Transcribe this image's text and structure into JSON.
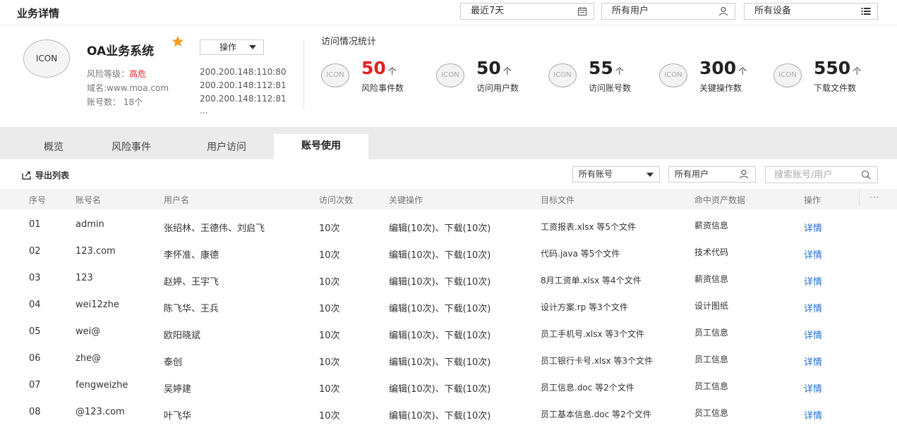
{
  "header": {
    "title": "业务详情",
    "date_filter": "最近7天",
    "user_filter": "所有用户",
    "device_filter": "所有设备"
  },
  "system": {
    "icon_label": "ICON",
    "name": "OA业务系统",
    "operation_label": "操作",
    "risk_label": "风险等级：",
    "risk_value": "高危",
    "domain": "域名:www.moa.com",
    "account_count": "账号数：  18个",
    "ips": [
      "200.200.148:110:80",
      "200.200.148:112:81",
      "200.200.148:112:81",
      "..."
    ],
    "accent_color": "#f0a020",
    "risk_color": "#e22222"
  },
  "stats": {
    "title": "访问情况统计",
    "items": [
      {
        "icon": "ICON",
        "value": "50",
        "unit": "个",
        "label": "风险事件数",
        "highlight": true
      },
      {
        "icon": "ICON",
        "value": "50",
        "unit": "个",
        "label": "访问用户数",
        "highlight": false
      },
      {
        "icon": "ICON",
        "value": "55",
        "unit": "个",
        "label": "访问账号数",
        "highlight": false
      },
      {
        "icon": "ICON",
        "value": "300",
        "unit": "个",
        "label": "关键操作数",
        "highlight": false
      },
      {
        "icon": "ICON",
        "value": "550",
        "unit": "个",
        "label": "下载文件数",
        "highlight": false
      }
    ]
  },
  "tabs": [
    {
      "label": "概览",
      "active": false
    },
    {
      "label": "风险事件",
      "active": false
    },
    {
      "label": "用户访问",
      "active": false
    },
    {
      "label": "账号使用",
      "active": true
    }
  ],
  "toolbar": {
    "export_label": "导出列表",
    "account_filter": "所有账号",
    "user_filter": "所有用户",
    "search_placeholder": "搜索账号/用户"
  },
  "table": {
    "columns": [
      "序号",
      "账号名",
      "用户名",
      "访问次数",
      "关键操作",
      "目标文件",
      "命中资产数据",
      "操作"
    ],
    "more": "···",
    "rows": [
      {
        "no": "01",
        "account": "admin",
        "users": "张绍林、王德伟、刘启飞",
        "visits": "10次",
        "ops": "编辑(10次)、下载(10次)",
        "files": "工资报表.xlsx 等5个文件",
        "asset": "薪资信息",
        "action": "详情"
      },
      {
        "no": "02",
        "account": "123.com",
        "users": "李怀准、康德",
        "visits": "10次",
        "ops": "编辑(10次)、下载(10次)",
        "files": "代码.java 等5个文件",
        "asset": "技术代码",
        "action": "详情"
      },
      {
        "no": "03",
        "account": "123",
        "users": "赵婷、王宇飞",
        "visits": "10次",
        "ops": "编辑(10次)、下载(10次)",
        "files": "8月工资单.xlsx 等4个文件",
        "asset": "薪资信息",
        "action": "详情"
      },
      {
        "no": "04",
        "account": "wei12zhe",
        "users": "陈飞华、王兵",
        "visits": "10次",
        "ops": "编辑(10次)、下载(10次)",
        "files": "设计方案.rp 等3个文件",
        "asset": "设计图纸",
        "action": "详情"
      },
      {
        "no": "05",
        "account": "wei@",
        "users": "欧阳晓斌",
        "visits": "10次",
        "ops": "编辑(10次)、下载(10次)",
        "files": "员工手机号.xlsx 等3个文件",
        "asset": "员工信息",
        "action": "详情"
      },
      {
        "no": "06",
        "account": "zhe@",
        "users": "泰创",
        "visits": "10次",
        "ops": "编辑(10次)、下载(10次)",
        "files": "员工银行卡号.xlsx 等3个文件",
        "asset": "员工信息",
        "action": "详情"
      },
      {
        "no": "07",
        "account": "fengweizhe",
        "users": "吴婷建",
        "visits": "10次",
        "ops": "编辑(10次)、下载(10次)",
        "files": "员工信息.doc 等2个文件",
        "asset": "员工信息",
        "action": "详情"
      },
      {
        "no": "08",
        "account": "@123.com",
        "users": "叶飞华",
        "visits": "10次",
        "ops": "编辑(10次)、下载(10次)",
        "files": "员工基本信息.doc 等2个文件",
        "asset": "员工信息",
        "action": "详情"
      }
    ]
  }
}
